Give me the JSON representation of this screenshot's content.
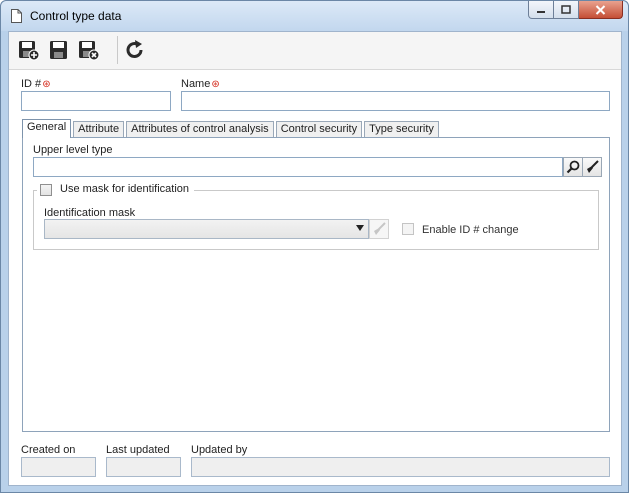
{
  "window": {
    "title": "Control type data",
    "controls": {
      "minimize": "minimize-icon",
      "maximize": "maximize-icon",
      "close": "close-icon"
    }
  },
  "toolbar": {
    "buttons": [
      {
        "name": "save-and-new",
        "icon": "save-new-icon"
      },
      {
        "name": "save",
        "icon": "save-icon"
      },
      {
        "name": "save-and-exit",
        "icon": "save-close-icon"
      },
      {
        "name": "refresh",
        "icon": "refresh-icon"
      }
    ]
  },
  "form": {
    "id_label": "ID #",
    "id_value": "",
    "name_label": "Name",
    "name_value": "",
    "required_marker": "⊛"
  },
  "tabs": [
    {
      "label": "General",
      "active": true
    },
    {
      "label": "Attribute",
      "active": false
    },
    {
      "label": "Attributes of control analysis",
      "active": false
    },
    {
      "label": "Control security",
      "active": false
    },
    {
      "label": "Type security",
      "active": false
    }
  ],
  "general": {
    "upper_level_label": "Upper level type",
    "upper_level_value": "",
    "use_mask_label": "Use mask for identification",
    "use_mask_checked": false,
    "mask_label": "Identification mask",
    "mask_selected": "",
    "enable_id_change_label": "Enable ID # change",
    "enable_id_change_checked": false
  },
  "footer": {
    "created_on_label": "Created on",
    "created_on_value": "",
    "last_updated_label": "Last updated",
    "last_updated_value": "",
    "updated_by_label": "Updated by",
    "updated_by_value": ""
  },
  "colors": {
    "frame": "#b9d1ea",
    "input_border": "#8ea8c3",
    "required": "#d42a1b",
    "close_button": "#c54f36"
  }
}
